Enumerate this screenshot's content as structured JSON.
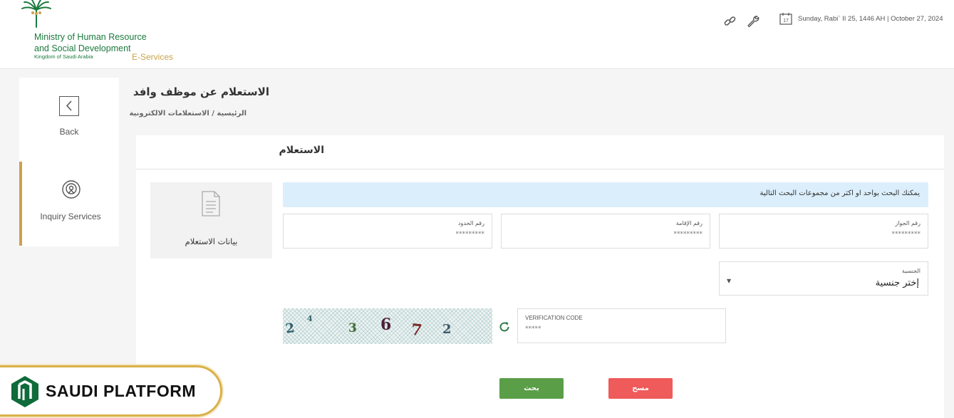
{
  "header": {
    "org_name_line1": "Ministry of Human Resource",
    "org_name_line2": "and Social Development",
    "org_sub": "Kingdom of Saudi Arabia",
    "eservices": "E-Services",
    "date": "Sunday, Rabi` II 25, 1446 AH | October 27, 2024",
    "calendar_day": "17",
    "icons": [
      "link-icon",
      "wrench-icon",
      "calendar-icon"
    ]
  },
  "sidebar": {
    "items": [
      {
        "label": "Back",
        "icon": "back-arrow-icon"
      },
      {
        "label": "Inquiry Services",
        "icon": "inquiry-services-icon"
      }
    ]
  },
  "page": {
    "title": "الاستعلام عن موظف وافد",
    "breadcrumb": "الرئيسية / الاستعلامات الالكترونية"
  },
  "card": {
    "title": "الاستعلام",
    "tile_label": "بيانات الاستعلام",
    "info": "يمكنك البحث بواحد او اكثر من مجموعات البحث التالية",
    "fields": {
      "passport": {
        "label": "رقم الجواز",
        "placeholder": "*********"
      },
      "iqama": {
        "label": "رقم الإقامة",
        "placeholder": "*********"
      },
      "border": {
        "label": "رقم الحدود",
        "placeholder": "*********"
      },
      "nationality": {
        "label": "الجنسية",
        "value": "إختر جنسية"
      },
      "verification": {
        "label": "VERIFICATION CODE",
        "placeholder": "*****"
      }
    },
    "captcha_text": "2⁴ 3672",
    "buttons": {
      "search": "بحث",
      "clear": "مسح"
    }
  },
  "badge": {
    "text": "SAUDI PLATFORM"
  },
  "colors": {
    "brand_green": "#1b7a3e",
    "gold": "#c9a24a",
    "search_green": "#5a9e48",
    "clear_red": "#ef5a5a",
    "info_blue": "#dbeefb"
  }
}
